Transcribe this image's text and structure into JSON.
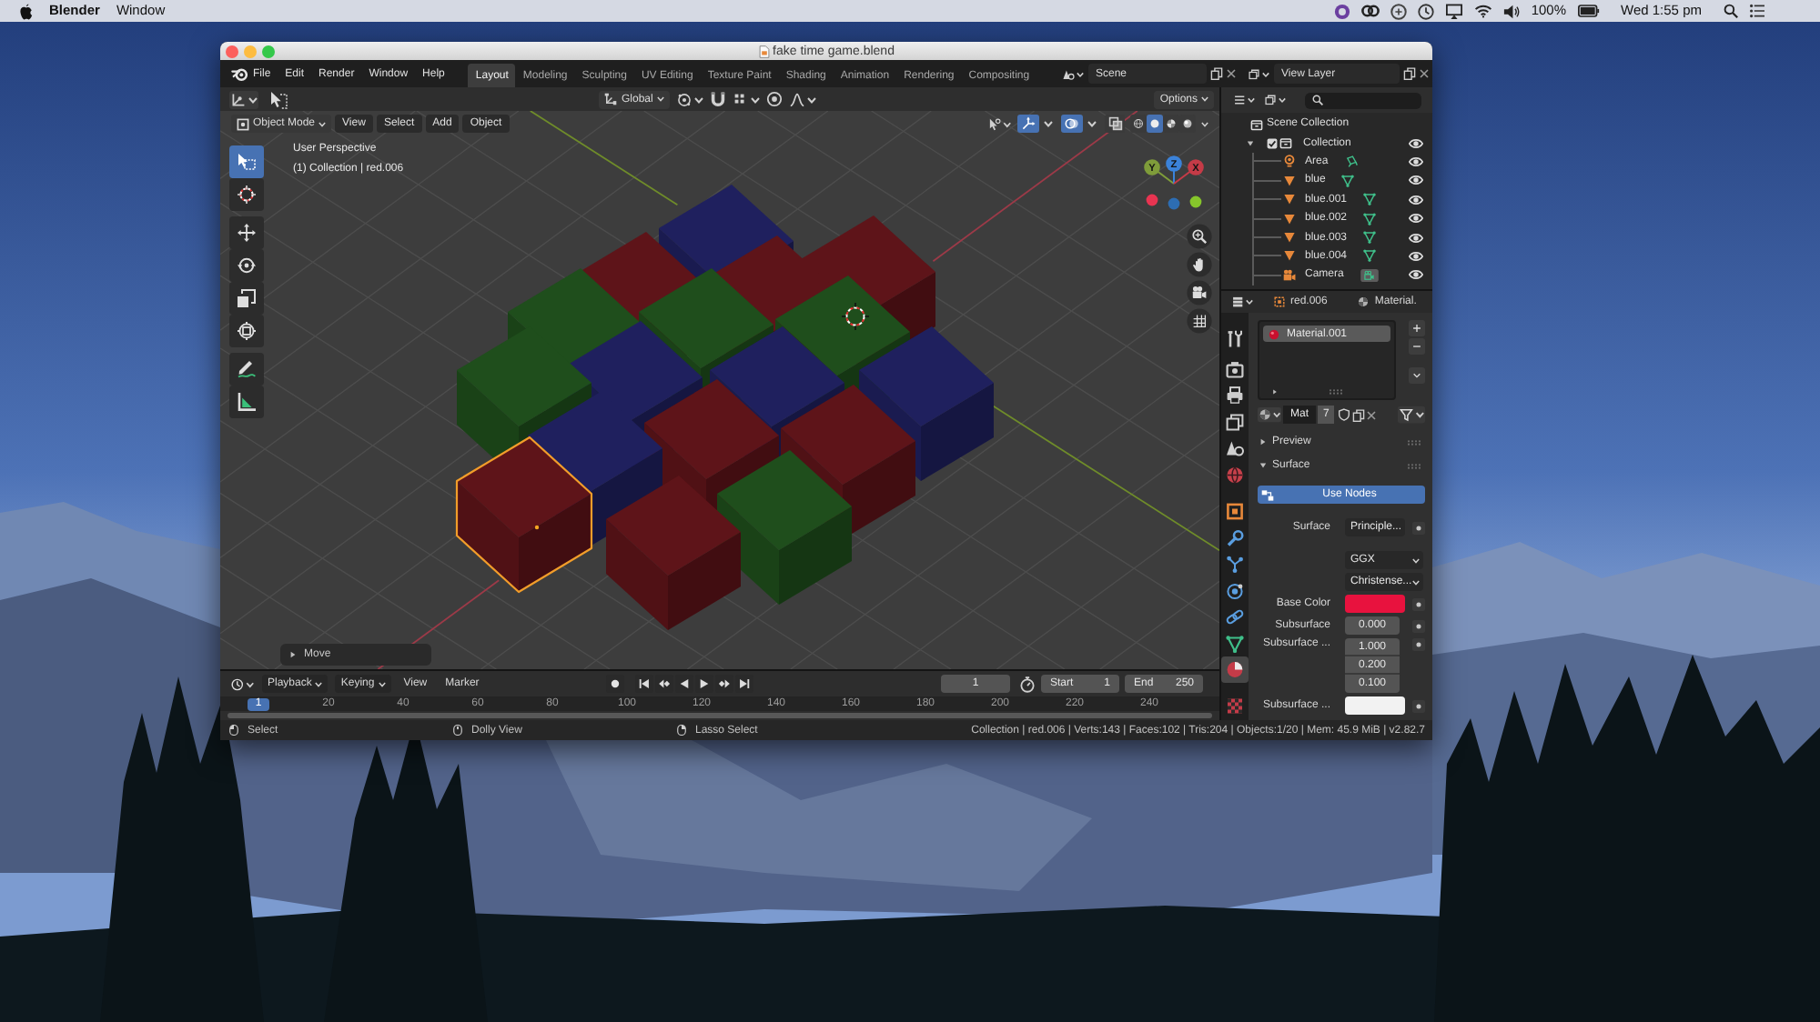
{
  "menu_bar": {
    "app": "Blender",
    "menus": [
      "Window"
    ],
    "battery": "100%",
    "clock": "Wed 1:55 pm"
  },
  "window": {
    "title": "fake time game.blend"
  },
  "top_bar": {
    "menus": [
      "File",
      "Edit",
      "Render",
      "Window",
      "Help"
    ],
    "workspaces": [
      {
        "label": "Layout",
        "selected": true
      },
      {
        "label": "Modeling",
        "selected": false
      },
      {
        "label": "Sculpting",
        "selected": false
      },
      {
        "label": "UV Editing",
        "selected": false
      },
      {
        "label": "Texture Paint",
        "selected": false
      },
      {
        "label": "Shading",
        "selected": false
      },
      {
        "label": "Animation",
        "selected": false
      },
      {
        "label": "Rendering",
        "selected": false
      },
      {
        "label": "Compositing",
        "selected": false
      }
    ],
    "scene": "Scene",
    "view_layer": "View Layer"
  },
  "viewport": {
    "orientation": "Global",
    "options": "Options",
    "mode": "Object Mode",
    "menus": [
      "View",
      "Select",
      "Add",
      "Object"
    ],
    "toggles": [
      {
        "kind": "gizmos",
        "on": true
      },
      {
        "kind": "overlays",
        "on": true
      },
      {
        "kind": "xray",
        "on": false
      }
    ],
    "shading": [
      {
        "kind": "wireframe",
        "selected": false
      },
      {
        "kind": "solid",
        "selected": true
      },
      {
        "kind": "material",
        "selected": false
      },
      {
        "kind": "rendered",
        "selected": false
      }
    ],
    "tools": [
      {
        "kind": "select",
        "selected": true
      },
      {
        "kind": "cursor",
        "selected": false
      },
      {
        "kind": "move",
        "selected": false
      },
      {
        "kind": "rotate",
        "selected": false
      },
      {
        "kind": "scale",
        "selected": false
      },
      {
        "kind": "transform",
        "selected": false
      },
      {
        "kind": "annotate",
        "selected": false
      },
      {
        "kind": "measure",
        "selected": false
      }
    ],
    "view_name": "User Perspective",
    "view_info": "(1) Collection | red.006",
    "gizmo_axes": [
      {
        "label": "Y",
        "color": "#7f9c3a"
      },
      {
        "label": "Z",
        "color": "#3b82d9"
      },
      {
        "label": "X",
        "color": "#c53b47"
      }
    ],
    "gizmo_negative": [
      {
        "color": "#e83451"
      },
      {
        "color": "#2d6db3"
      },
      {
        "color": "#86c52b"
      }
    ],
    "selection_outline": true,
    "operator_panel": {
      "label": "Move",
      "expanded": false
    }
  },
  "timeline": {
    "menus": [
      {
        "label": "Playback",
        "kind": "dropdown"
      },
      {
        "label": "Keying",
        "kind": "dropdown"
      },
      {
        "label": "View",
        "kind": "menu"
      },
      {
        "label": "Marker",
        "kind": "menu"
      }
    ],
    "current_frame": "1",
    "start_label": "Start",
    "start": "1",
    "end_label": "End",
    "end": "250",
    "playhead": "1",
    "ruler": [
      "20",
      "40",
      "60",
      "80",
      "100",
      "120",
      "140",
      "160",
      "180",
      "200",
      "220",
      "240"
    ]
  },
  "outliner": {
    "rows": [
      {
        "label": "Scene Collection",
        "kind": "scene",
        "children": [
          {
            "label": "Collection",
            "kind": "collection",
            "checked": true,
            "expanded": true,
            "visible": true,
            "children": [
              {
                "label": "Area",
                "kind": "light",
                "visible": true,
                "data_active": false
              },
              {
                "label": "blue",
                "kind": "mesh",
                "visible": true,
                "data_active": false
              },
              {
                "label": "blue.001",
                "kind": "mesh",
                "visible": true,
                "data_active": false
              },
              {
                "label": "blue.002",
                "kind": "mesh",
                "visible": true,
                "data_active": false
              },
              {
                "label": "blue.003",
                "kind": "mesh",
                "visible": true,
                "data_active": false
              },
              {
                "label": "blue.004",
                "kind": "mesh",
                "visible": true,
                "data_active": false
              },
              {
                "label": "Camera",
                "kind": "camera",
                "visible": true,
                "data_active": true
              }
            ]
          }
        ]
      }
    ]
  },
  "properties": {
    "object": "red.006",
    "material_tab": "Material.",
    "tabs": [
      {
        "kind": "tool",
        "selected": false
      },
      {
        "kind": "render",
        "selected": false
      },
      {
        "kind": "output",
        "selected": false
      },
      {
        "kind": "view_layer",
        "selected": false
      },
      {
        "kind": "scene",
        "selected": false
      },
      {
        "kind": "world",
        "selected": false
      },
      {
        "kind": "object",
        "selected": false
      },
      {
        "kind": "modifier",
        "selected": false
      },
      {
        "kind": "particles",
        "selected": false
      },
      {
        "kind": "physics",
        "selected": false
      },
      {
        "kind": "constraints",
        "selected": false
      },
      {
        "kind": "data",
        "selected": false
      },
      {
        "kind": "material",
        "selected": true
      },
      {
        "kind": "texture",
        "selected": false
      }
    ],
    "slots": [
      {
        "label": "Material.001",
        "selected": true
      }
    ],
    "material": {
      "name": "Mat",
      "users": "7"
    },
    "panels": [
      {
        "label": "Preview",
        "expanded": false
      },
      {
        "label": "Surface",
        "expanded": true
      }
    ],
    "use_nodes": {
      "label": "Use Nodes",
      "on": true
    },
    "inputs": [
      {
        "kind": "socket",
        "label": "Surface",
        "value": "Principle..."
      },
      {
        "kind": "enum",
        "value": "GGX"
      },
      {
        "kind": "enum",
        "value": "Christense..."
      },
      {
        "kind": "color",
        "label": "Base Color",
        "color": "#e8123e"
      },
      {
        "kind": "number",
        "label": "Subsurface",
        "value": "0.000"
      },
      {
        "kind": "vector",
        "label": "Subsurface ...",
        "values": [
          "1.000",
          "0.200",
          "0.100"
        ]
      },
      {
        "kind": "color",
        "label": "Subsurface ...",
        "color": "#f2f2f2"
      }
    ]
  },
  "status_bar": {
    "hints": [
      {
        "kind": "left",
        "label": "Select"
      },
      {
        "kind": "middle",
        "label": "Dolly View"
      },
      {
        "kind": "right",
        "label": "Lasso Select"
      }
    ],
    "stats": "Collection | red.006 | Verts:143 | Faces:102 | Tris:204 | Objects:1/20 | Mem: 45.9 MiB | v2.82.7"
  }
}
